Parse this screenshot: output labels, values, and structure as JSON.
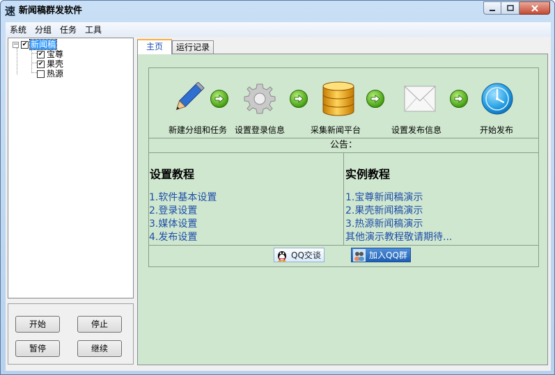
{
  "window": {
    "title": "新闻稿群发软件",
    "app_icon_glyph": "速"
  },
  "menu": [
    "系统",
    "分组",
    "任务",
    "工具"
  ],
  "tree": {
    "root": {
      "label": "新闻稿",
      "checked": true,
      "expander": "⊟"
    },
    "children": [
      {
        "label": "宝尊",
        "checked": true
      },
      {
        "label": "果壳",
        "checked": true
      },
      {
        "label": "热源",
        "checked": false
      }
    ]
  },
  "controls": {
    "start": "开始",
    "stop": "停止",
    "pause": "暂停",
    "resume": "继续"
  },
  "tabs": [
    {
      "label": "主页",
      "active": true
    },
    {
      "label": "运行记录",
      "active": false
    }
  ],
  "flow": [
    {
      "label": "新建分组和任务",
      "icon": "pencil-icon"
    },
    {
      "label": "设置登录信息",
      "icon": "gear-icon"
    },
    {
      "label": "采集新闻平台",
      "icon": "database-icon"
    },
    {
      "label": "设置发布信息",
      "icon": "envelope-icon"
    },
    {
      "label": "开始发布",
      "icon": "clock-icon"
    }
  ],
  "notice": "公告：",
  "setup": {
    "title": "设置教程",
    "links": [
      "1.软件基本设置",
      "2.登录设置",
      "3.媒体设置",
      "4.发布设置"
    ]
  },
  "examples": {
    "title": "实例教程",
    "links": [
      "1.宝尊新闻稿演示",
      "2.果壳新闻稿演示",
      "3.热源新闻稿演示",
      "其他演示教程敬请期待..."
    ]
  },
  "qq": {
    "talk": "QQ交谈",
    "group": "加入QQ群"
  },
  "colors": {
    "panel_green": "#cfe7cf",
    "link_blue": "#1f4ea8",
    "selected_blue": "#3399ff"
  }
}
